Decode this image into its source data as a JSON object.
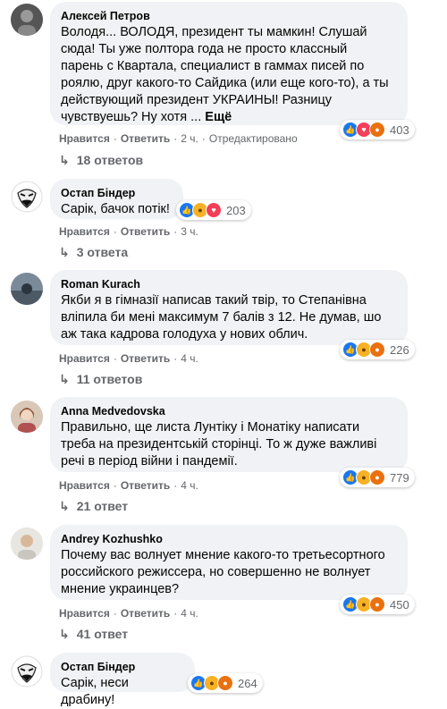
{
  "comments": [
    {
      "author": "Алексей Петров",
      "lines": [
        "Володя... ВОЛОДЯ, президент ты мамкин! Слушай",
        "сюда! Ты уже полтора года не просто классный",
        "парень с Квартала, специалист в гаммах писей по",
        "роялю, друг какого-то Сайдика (или еще кого-то), а ты",
        "действующий президент УКРАИНЫ! Разницу",
        "чувствуешь? Ну хотя ... "
      ],
      "more": "Ещё",
      "like": "Нравится",
      "reply": "Ответить",
      "time": "2 ч.",
      "edited": "Отредактировано",
      "reactions": [
        "like",
        "love",
        "angry"
      ],
      "count": "403",
      "replies": "18 ответов"
    },
    {
      "author": "Остап Біндер",
      "lines": [
        "Сарік, бачок потік!"
      ],
      "like": "Нравится",
      "reply": "Ответить",
      "time": "3 ч.",
      "reactions": [
        "like",
        "haha",
        "love"
      ],
      "count": "203",
      "replies": "3 ответа"
    },
    {
      "author": "Roman Kurach",
      "lines": [
        "Якби я в гімназії написав такий твір, то Степанівна",
        "вліпила би мені максимум 7 балів з 12. Не думав, шо",
        "аж така кадрова голодуха у нових облич."
      ],
      "like": "Нравится",
      "reply": "Ответить",
      "time": "4 ч.",
      "reactions": [
        "like",
        "haha",
        "angry"
      ],
      "count": "226",
      "replies": "11 ответов"
    },
    {
      "author": "Anna Medvedovska",
      "lines": [
        "Правильно, ще листа Лунтіку і Монатіку написати",
        "треба на президентській сторінці. То ж дуже важливі",
        "речі в період війни і пандемії."
      ],
      "like": "Нравится",
      "reply": "Ответить",
      "time": "4 ч.",
      "reactions": [
        "like",
        "haha",
        "angry"
      ],
      "count": "779",
      "replies": "21 ответ"
    },
    {
      "author": "Andrey Kozhushko",
      "lines": [
        "Почему вас волнует мнение какого-то третьесортного",
        "российского режиссера, но совершенно не волнует",
        "мнение украинцев?"
      ],
      "like": "Нравится",
      "reply": "Ответить",
      "time": "4 ч.",
      "reactions": [
        "like",
        "haha",
        "angry"
      ],
      "count": "450",
      "replies": "41 ответ"
    },
    {
      "author": "Остап Біндер",
      "lines": [
        "Сарік, неси драбину!"
      ],
      "reactions": [
        "like",
        "haha",
        "angry"
      ],
      "count": "264"
    }
  ]
}
